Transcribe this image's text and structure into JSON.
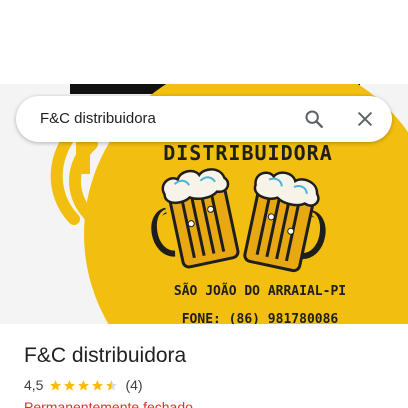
{
  "search": {
    "query": "F&C distribuidora"
  },
  "hero_image": {
    "line1": "DISTRIBUIDORA",
    "line2": "SÃO JOÃO DO ARRAIAL-PI",
    "line3": "FONE: (86) 981780086"
  },
  "place": {
    "name": "F&C distribuidora",
    "rating": "4,5",
    "stars": 4.5,
    "review_count": "(4)",
    "status": "Permanentemente fechado"
  },
  "colors": {
    "brand_yellow": "#f2be0f",
    "star_yellow": "#fbbc04",
    "status_red": "#d93025"
  },
  "icons": {
    "search": "search-icon",
    "close": "close-icon",
    "star": "star-icon"
  }
}
